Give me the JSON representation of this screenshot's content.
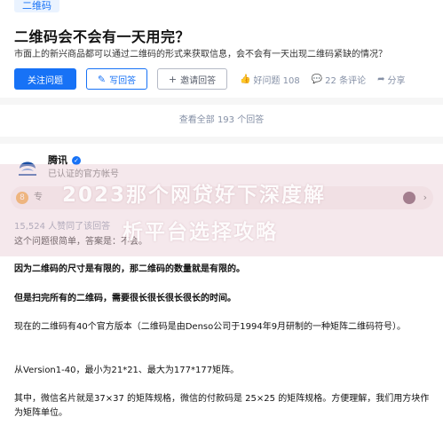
{
  "question": {
    "topic": "二维码",
    "title": "二维码会不会有一天用完？",
    "detail": "市面上的新兴商品都可以通过二维码的形式来获取信息，会不会有一天出现二维码紧缺的情况？",
    "follow_label": "关注问题",
    "write_label": "写回答",
    "invite_label": "邀请回答",
    "good_question": "好问题 108",
    "comments": "22 条评论",
    "share": "分享"
  },
  "view_all": "查看全部 193 个回答",
  "answer": {
    "author": "腾讯",
    "author_desc": "已认证的官方帐号",
    "approve_count": "15,524 人赞同了该回答",
    "paragraphs": [
      "这个问题很简单，答案是：不会。",
      "因为二维码的尺寸是有限的，那二维码的数量就是有限的。",
      "但是扫完所有的二维码，需要很长很长很长很长的时间。",
      "现在的二维码有40个官方版本（二维码是由Denso公司于1994年9月研制的一种矩阵二维码符号）。",
      "从Version1-40，最小为21*21、最大为177*177矩阵。",
      "其中，微信名片就是37×37 的矩阵规格，微信的付款码是 25×25 的矩阵规格。方便理解，我们用方块作为矩阵单位。"
    ]
  },
  "watermark": {
    "line1": "2023那个网贷好下深度解",
    "line2": "析平台选择攻略"
  },
  "colors": {
    "accent": "#1772f6",
    "muted": "#8590a6"
  }
}
